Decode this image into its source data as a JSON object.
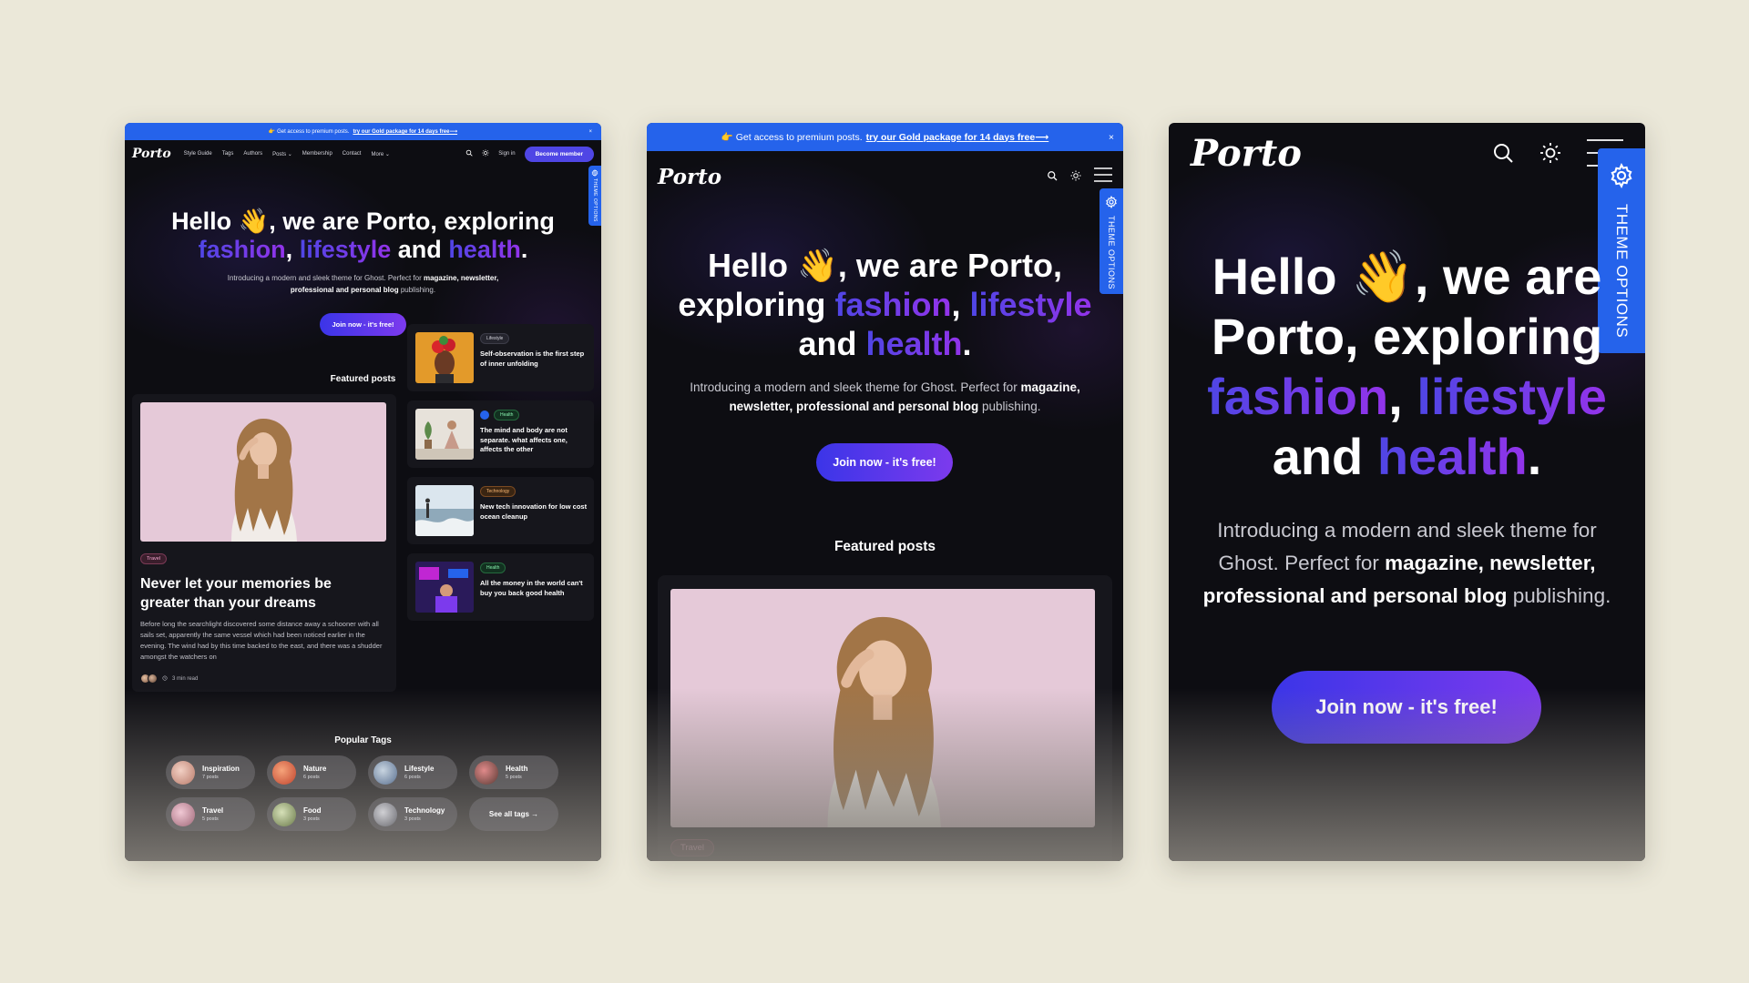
{
  "announcement": {
    "emoji": "👉",
    "text": "Get access to premium posts.",
    "cta": "try our Gold package for 14 days free⟶",
    "close": "×"
  },
  "brand": {
    "logo": "Porto"
  },
  "nav": {
    "links": [
      "Style Guide",
      "Tags",
      "Authors",
      "Posts ⌄",
      "Membership",
      "Contact",
      "More ⌄"
    ],
    "signin": "Sign in",
    "become_member": "Become member"
  },
  "theme_options": "THEME OPTIONS",
  "hero": {
    "line1": "Hello",
    "wave": "👋",
    "line1b": ", we are Porto, exploring",
    "fashion": "fashion",
    "comma": ",",
    "lifestyle": "lifestyle",
    "and": "and",
    "health": "health",
    "period": ".",
    "desc_a": "Introducing a modern and sleek theme for Ghost. Perfect for",
    "desc_b": "magazine, newsletter, professional and personal blog",
    "desc_c": "publishing.",
    "join": "Join now - it's free!"
  },
  "featured": {
    "title": "Featured posts",
    "main": {
      "tag": "Travel",
      "title": "Never let your memories be greater than your dreams",
      "excerpt": "Before long the searchlight discovered some distance away a schooner with all sails set, apparently the same vessel which had been noticed earlier in the evening. The wind had by this time backed to the east, and there was a shudder amongst the watchers on",
      "read_time": "3 min read"
    },
    "side": [
      {
        "tag": "Lifestyle",
        "title": "Self-observation is the first step of inner unfolding"
      },
      {
        "tag": "Health",
        "title": "The mind and body are not separate. what affects one, affects the other"
      },
      {
        "tag": "Technology",
        "title": "New tech innovation for low cost ocean cleanup"
      },
      {
        "tag": "Health",
        "title": "All the money in the world can't buy you back good health"
      }
    ]
  },
  "popular_tags": {
    "title": "Popular Tags",
    "items": [
      {
        "name": "Inspiration",
        "count": "7 posts"
      },
      {
        "name": "Nature",
        "count": "6 posts"
      },
      {
        "name": "Lifestyle",
        "count": "6 posts"
      },
      {
        "name": "Health",
        "count": "5 posts"
      },
      {
        "name": "Travel",
        "count": "5 posts"
      },
      {
        "name": "Food",
        "count": "3 posts"
      },
      {
        "name": "Technology",
        "count": "3 posts"
      }
    ],
    "see_all": "See all tags →"
  },
  "colors": {
    "accent_blue": "#2563eb",
    "gradient_start": "#4f46e5",
    "gradient_end": "#9333ea",
    "background": "#0d0d12",
    "page_backdrop": "#ebe8d9"
  }
}
